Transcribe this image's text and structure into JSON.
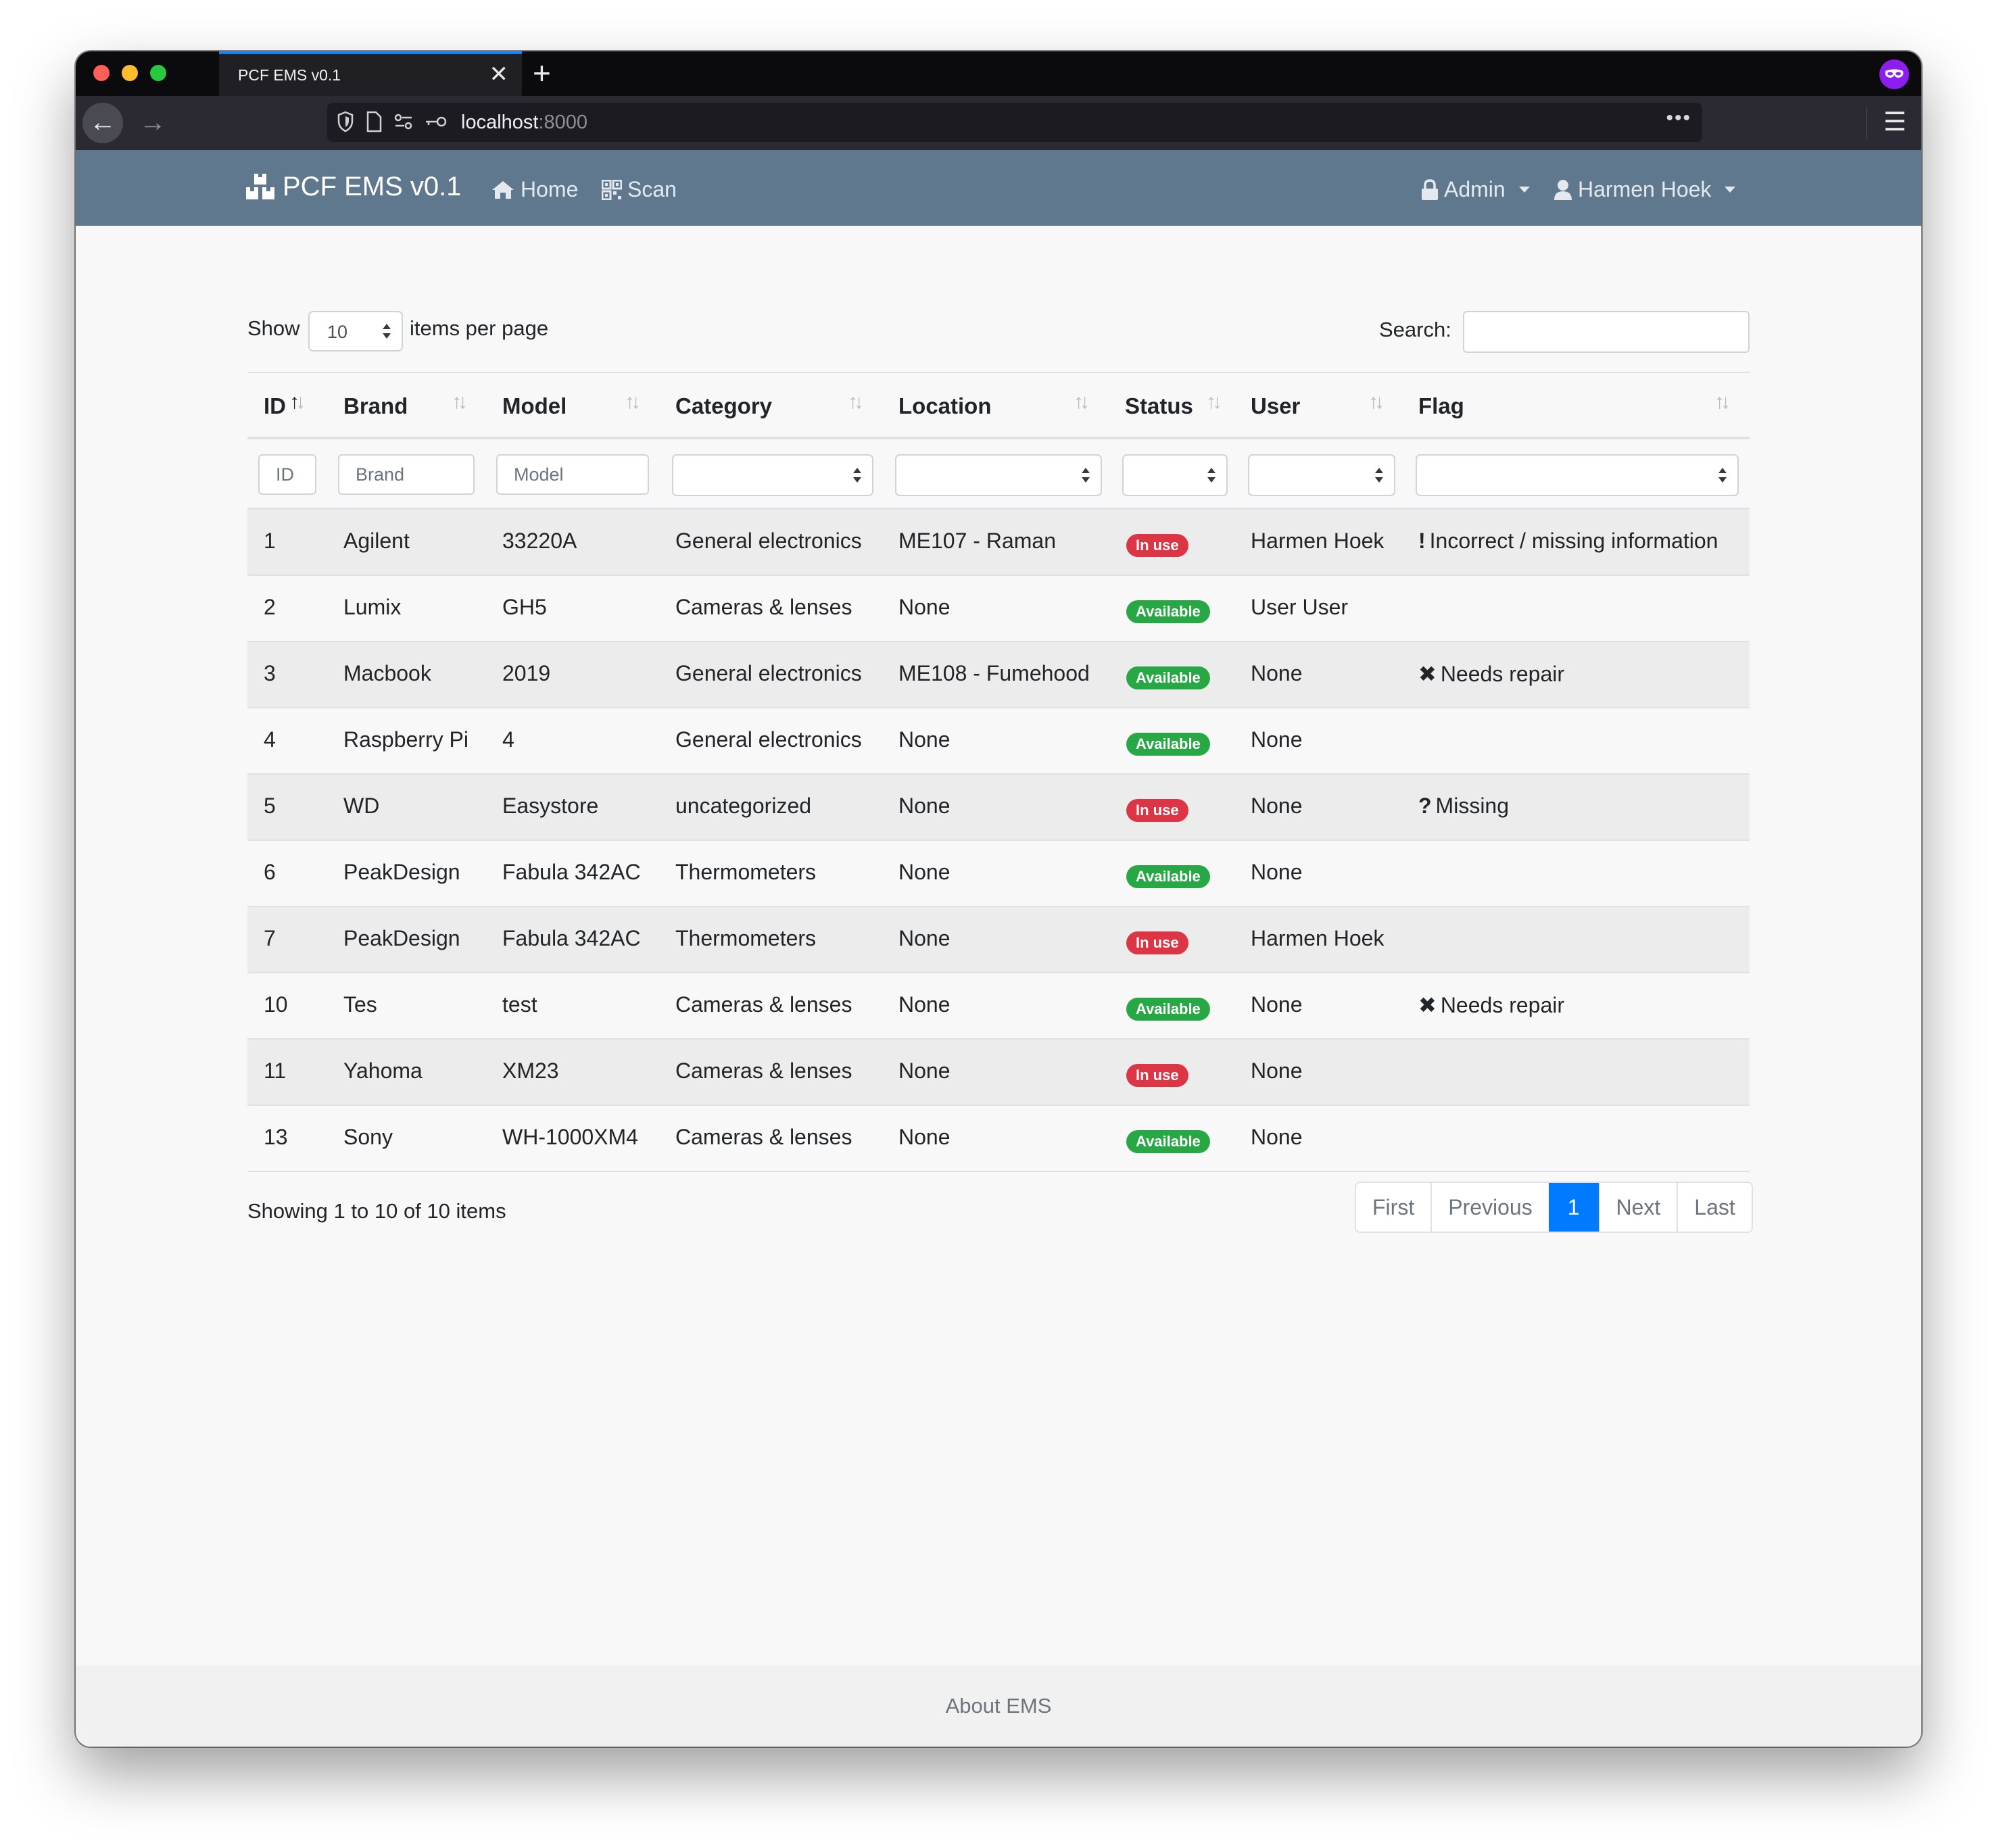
{
  "browser": {
    "tab_title": "PCF EMS v0.1",
    "tab_close": "✕",
    "new_tab": "+",
    "url_host": "localhost",
    "url_port": ":8000",
    "url_more": "•••",
    "menu": "☰",
    "back": "←",
    "forward": "→"
  },
  "navbar": {
    "brand": "PCF EMS v0.1",
    "home": "Home",
    "scan": "Scan",
    "admin": "Admin",
    "user": "Harmen Hoek"
  },
  "controls": {
    "show_label": "Show",
    "per_page_value": "10",
    "items_per_page_label": "items per page",
    "search_label": "Search:",
    "search_value": ""
  },
  "table": {
    "headers": [
      "ID",
      "Brand",
      "Model",
      "Category",
      "Location",
      "Status",
      "User",
      "Flag"
    ],
    "filter_placeholders": {
      "id": "ID",
      "brand": "Brand",
      "model": "Model"
    },
    "rows": [
      {
        "id": "1",
        "brand": "Agilent",
        "model": "33220A",
        "category": "General electronics",
        "location": "ME107 - Raman",
        "status": "In use",
        "user": "Harmen Hoek",
        "flag_icon": "!",
        "flag": "Incorrect / missing information"
      },
      {
        "id": "2",
        "brand": "Lumix",
        "model": "GH5",
        "category": "Cameras & lenses",
        "location": "None",
        "status": "Available",
        "user": "User User",
        "flag_icon": "",
        "flag": ""
      },
      {
        "id": "3",
        "brand": "Macbook",
        "model": "2019",
        "category": "General electronics",
        "location": "ME108 - Fumehood",
        "status": "Available",
        "user": "None",
        "flag_icon": "✖",
        "flag": "Needs repair"
      },
      {
        "id": "4",
        "brand": "Raspberry Pi",
        "model": "4",
        "category": "General electronics",
        "location": "None",
        "status": "Available",
        "user": "None",
        "flag_icon": "",
        "flag": ""
      },
      {
        "id": "5",
        "brand": "WD",
        "model": "Easystore",
        "category": "uncategorized",
        "location": "None",
        "status": "In use",
        "user": "None",
        "flag_icon": "?",
        "flag": "Missing"
      },
      {
        "id": "6",
        "brand": "PeakDesign",
        "model": "Fabula 342AC",
        "category": "Thermometers",
        "location": "None",
        "status": "Available",
        "user": "None",
        "flag_icon": "",
        "flag": ""
      },
      {
        "id": "7",
        "brand": "PeakDesign",
        "model": "Fabula 342AC",
        "category": "Thermometers",
        "location": "None",
        "status": "In use",
        "user": "Harmen Hoek",
        "flag_icon": "",
        "flag": ""
      },
      {
        "id": "10",
        "brand": "Tes",
        "model": "test",
        "category": "Cameras & lenses",
        "location": "None",
        "status": "Available",
        "user": "None",
        "flag_icon": "✖",
        "flag": "Needs repair"
      },
      {
        "id": "11",
        "brand": "Yahoma",
        "model": "XM23",
        "category": "Cameras & lenses",
        "location": "None",
        "status": "In use",
        "user": "None",
        "flag_icon": "",
        "flag": ""
      },
      {
        "id": "13",
        "brand": "Sony",
        "model": "WH-1000XM4",
        "category": "Cameras & lenses",
        "location": "None",
        "status": "Available",
        "user": "None",
        "flag_icon": "",
        "flag": ""
      }
    ]
  },
  "status_colors": {
    "In use": "#dc3545",
    "Available": "#28a745"
  },
  "summary": "Showing 1 to 10 of 10 items",
  "pagination": {
    "first": "First",
    "previous": "Previous",
    "current": "1",
    "next": "Next",
    "last": "Last"
  },
  "footer": {
    "about": "About EMS"
  },
  "colors": {
    "navbar": "#5f788d",
    "active_page": "#007bff"
  }
}
